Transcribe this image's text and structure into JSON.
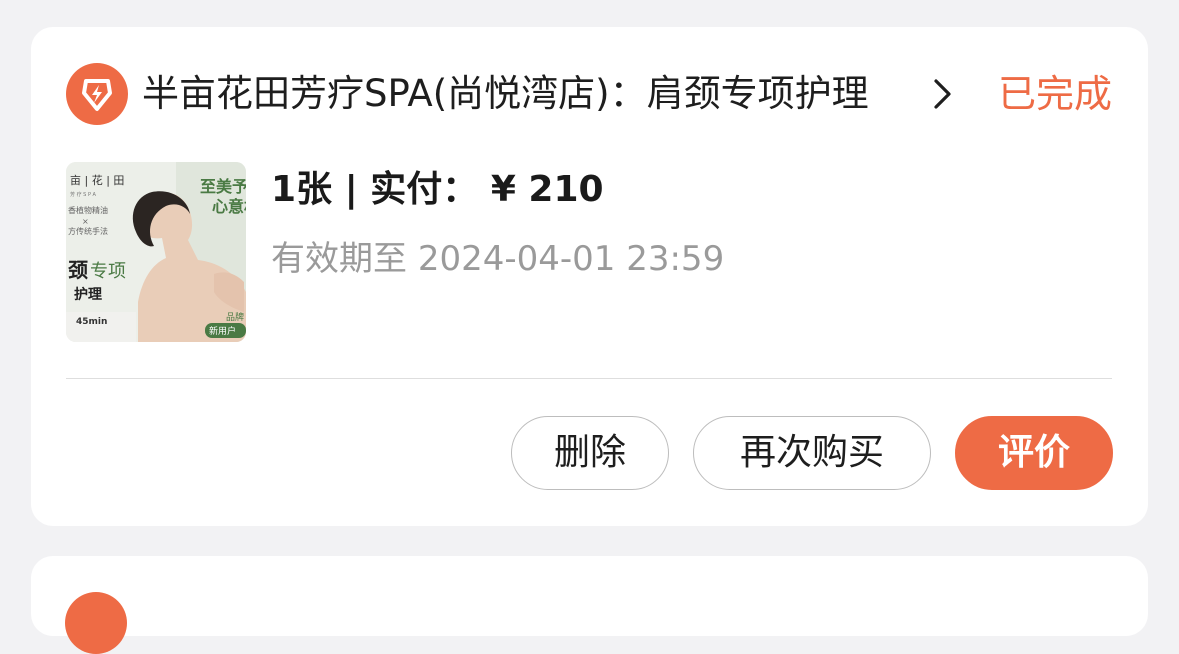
{
  "order": {
    "shop_name": "半亩花田芳疗SPA(尚悦湾店)：肩颈专项护理",
    "status": "已完成",
    "quantity_label": "1张 | 实付：",
    "price": "¥ 210",
    "expiry_label": "有效期至",
    "expiry_date": "2024-04-01 23:59",
    "thumbnail": {
      "brand": "亩 | 花 | 田",
      "brand_sub": "芳 疗 S P A",
      "line1": "香植物精油",
      "line2": "×",
      "line3": "方传统手法",
      "headline_green_1": "至美予你",
      "headline_green_2": "心意相",
      "title_big": "颈",
      "title_rest": "专项",
      "title_line2": "护理",
      "duration": "45min",
      "brand_tag": "品牌",
      "new_user_tag": "新用户"
    },
    "actions": {
      "delete": "删除",
      "rebuy": "再次购买",
      "review": "评价"
    }
  },
  "colors": {
    "accent": "#ee6b45",
    "background": "#f2f2f4",
    "card": "#ffffff",
    "thumbnail_green": "#4a7a44"
  },
  "icons": {
    "shop_logo": "lightning-bolt-icon",
    "chevron": "chevron-right-icon"
  }
}
